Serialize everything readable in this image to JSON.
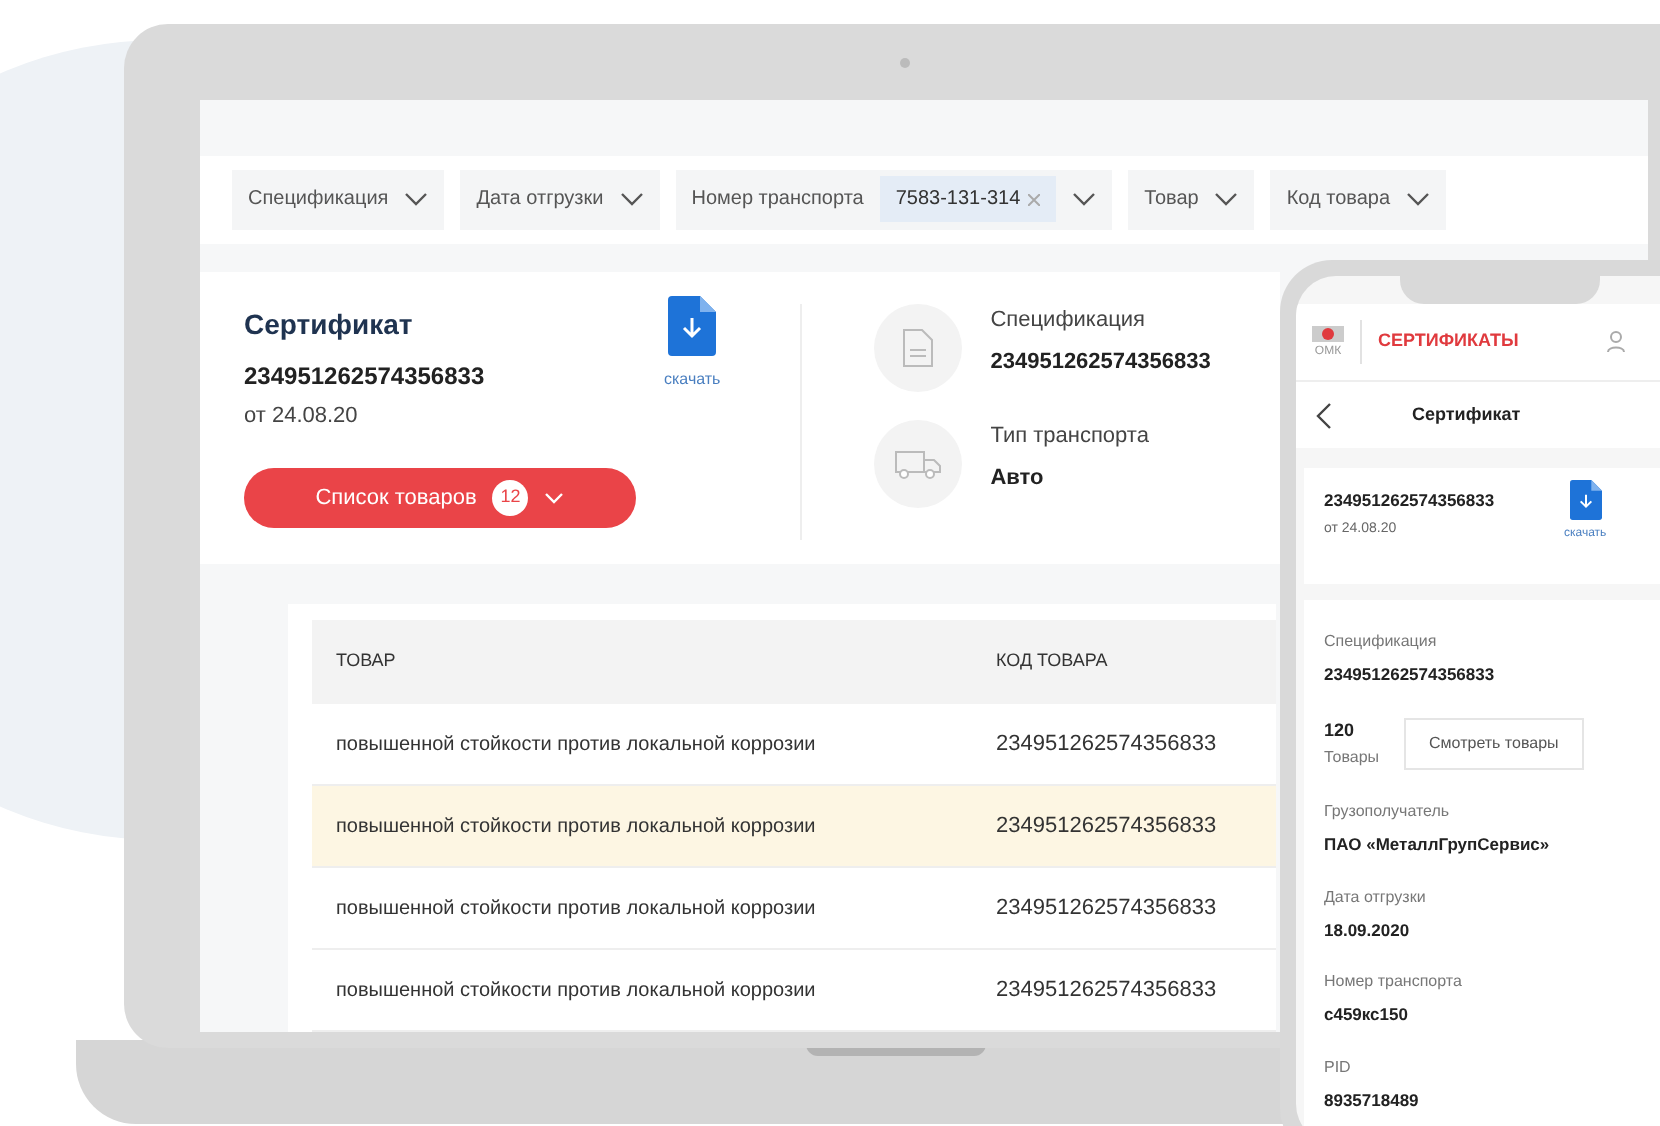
{
  "filters": [
    {
      "label": "Спецификация"
    },
    {
      "label": "Дата отгрузки"
    },
    {
      "label": "Номер транспорта",
      "value": "7583-131-314"
    },
    {
      "label": "Товар"
    },
    {
      "label": "Код товара"
    }
  ],
  "certificate": {
    "title": "Сертификат",
    "number": "234951262574356833",
    "date": "от 24.08.20",
    "download": "скачать",
    "list_button": "Список товаров",
    "list_count": "12"
  },
  "details": [
    {
      "kind": "document",
      "label": "Спецификация",
      "value": "234951262574356833"
    },
    {
      "kind": "truck",
      "label": "Тип транспорта",
      "value": "Авто"
    }
  ],
  "table": {
    "columns": [
      "ТОВАР",
      "КОД ТОВАРА"
    ],
    "rows": [
      {
        "product": "повышенной стойкости против локальной коррозии",
        "code": "234951262574356833",
        "selected": false
      },
      {
        "product": "повышенной стойкости против локальной коррозии",
        "code": "234951262574356833",
        "selected": true
      },
      {
        "product": "повышенной стойкости против локальной коррозии",
        "code": "234951262574356833",
        "selected": false
      },
      {
        "product": "повышенной стойкости против локальной коррозии",
        "code": "234951262574356833",
        "selected": false
      }
    ]
  },
  "phone": {
    "brand": "ОМК",
    "app_title": "СЕРТИФИКАТЫ",
    "screen_title": "Сертификат",
    "number": "234951262574356833",
    "date": "от 24.08.20",
    "download": "скачать",
    "fields": [
      {
        "kind": "text",
        "label": "Спецификация",
        "value": "234951262574356833"
      },
      {
        "kind": "count",
        "value": "120",
        "label": "Товары",
        "button": "Смотреть товары"
      },
      {
        "kind": "text",
        "label": "Грузополучатель",
        "value": "ПАО «МеталлГрупСервис»"
      },
      {
        "kind": "text",
        "label": "Дата отгрузки",
        "value": "18.09.2020"
      },
      {
        "kind": "text",
        "label": "Номер транспорта",
        "value": "с459кс150"
      },
      {
        "kind": "text",
        "label": "PID",
        "value": "8935718489"
      }
    ]
  }
}
